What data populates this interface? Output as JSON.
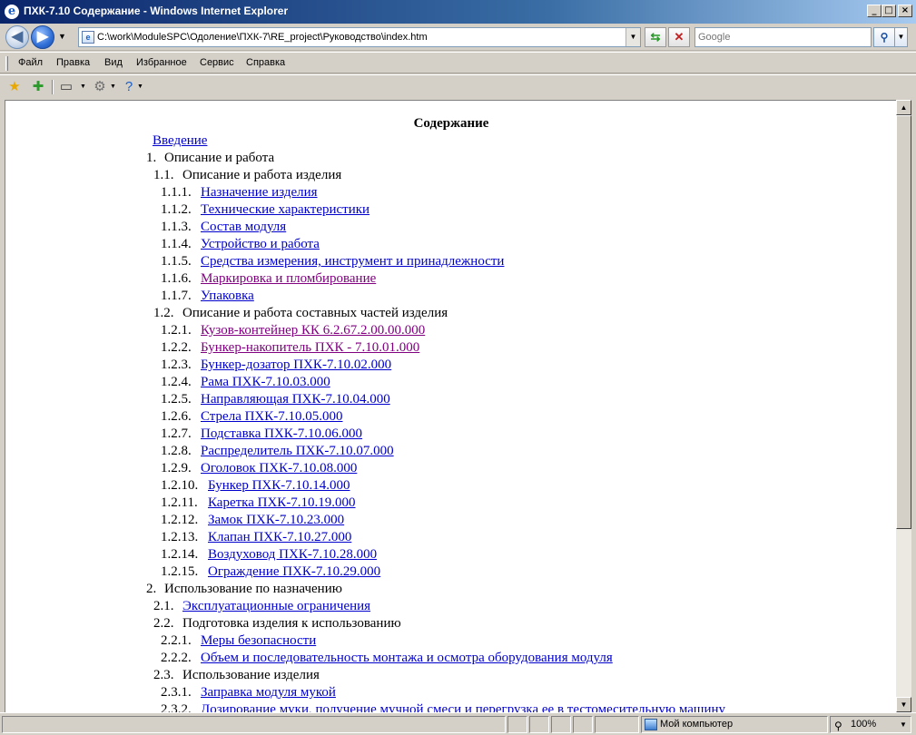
{
  "window": {
    "title": "ПХК-7.10 Содержание - Windows Internet Explorer",
    "minimize": "_",
    "maximize": "□",
    "close": "×"
  },
  "address": {
    "url": "C:\\work\\ModuleSPC\\Одоление\\ПХК-7\\RE_project\\Руководство\\index.htm"
  },
  "search": {
    "placeholder": "Google"
  },
  "menu": [
    "Файл",
    "Правка",
    "Вид",
    "Избранное",
    "Сервис",
    "Справка"
  ],
  "toolbar_icons": [
    "favorites-star-icon",
    "add-favorites-icon",
    "print-icon",
    "tools-gear-icon",
    "help-icon"
  ],
  "page": {
    "heading": "Содержание",
    "toc": [
      {
        "num": "",
        "text": "Введение",
        "link": true
      },
      {
        "num": "1.",
        "text": "Описание и работа",
        "link": false
      },
      {
        "num": "1.1.",
        "text": "Описание и работа изделия",
        "link": false
      },
      {
        "num": "1.1.1.",
        "text": "Назначение изделия",
        "link": true
      },
      {
        "num": "1.1.2.",
        "text": "Технические характеристики",
        "link": true
      },
      {
        "num": "1.1.3.",
        "text": "Состав модуля",
        "link": true
      },
      {
        "num": "1.1.4.",
        "text": "Устройство и работа",
        "link": true
      },
      {
        "num": "1.1.5.",
        "text": "Средства измерения, инструмент и принадлежности",
        "link": true
      },
      {
        "num": "1.1.6.",
        "text": "Маркировка и пломбирование",
        "link": true,
        "visited": true
      },
      {
        "num": "1.1.7.",
        "text": "Упаковка",
        "link": true
      },
      {
        "num": "1.2.",
        "text": "Описание и работа составных частей изделия",
        "link": false
      },
      {
        "num": "1.2.1.",
        "text": "Кузов-контейнер КК 6.2.67.2.00.00.000",
        "link": true,
        "visited": true
      },
      {
        "num": "1.2.2.",
        "text": "Бункер-накопитель ПХК - 7.10.01.000",
        "link": true,
        "visited": true
      },
      {
        "num": "1.2.3.",
        "text": "Бункер-дозатор ПХК-7.10.02.000",
        "link": true
      },
      {
        "num": "1.2.4.",
        "text": "Рама ПХК-7.10.03.000",
        "link": true
      },
      {
        "num": "1.2.5.",
        "text": "Направляющая ПХК-7.10.04.000",
        "link": true
      },
      {
        "num": "1.2.6.",
        "text": "Стрела ПХК-7.10.05.000",
        "link": true
      },
      {
        "num": "1.2.7.",
        "text": "Подставка ПХК-7.10.06.000",
        "link": true
      },
      {
        "num": "1.2.8.",
        "text": "Распределитель ПХК-7.10.07.000",
        "link": true
      },
      {
        "num": "1.2.9.",
        "text": "Оголовок ПХК-7.10.08.000",
        "link": true
      },
      {
        "num": "1.2.10.",
        "text": "Бункер ПХК-7.10.14.000",
        "link": true
      },
      {
        "num": "1.2.11.",
        "text": "Каретка ПХК-7.10.19.000",
        "link": true
      },
      {
        "num": "1.2.12.",
        "text": "Замок ПХК-7.10.23.000",
        "link": true
      },
      {
        "num": "1.2.13.",
        "text": "Клапан ПХК-7.10.27.000",
        "link": true
      },
      {
        "num": "1.2.14.",
        "text": "Воздуховод ПХК-7.10.28.000",
        "link": true
      },
      {
        "num": "1.2.15.",
        "text": "Ограждение ПХК-7.10.29.000",
        "link": true
      },
      {
        "num": "2.",
        "text": "Использование по назначению",
        "link": false
      },
      {
        "num": "2.1.",
        "text": "Эксплуатационные ограничения",
        "link": true
      },
      {
        "num": "2.2.",
        "text": "Подготовка изделия к использованию",
        "link": false
      },
      {
        "num": "2.2.1.",
        "text": "Меры безопасности",
        "link": true
      },
      {
        "num": "2.2.2.",
        "text": "Объем и последовательность монтажа и осмотра оборудования модуля",
        "link": true
      },
      {
        "num": "2.3.",
        "text": "Использование изделия",
        "link": false
      },
      {
        "num": "2.3.1.",
        "text": "Заправка модуля мукой",
        "link": true
      },
      {
        "num": "2.3.2.",
        "text": "Дозирование муки, получение мучной смеси и перегрузка ее в тестомесительную машину",
        "link": true
      }
    ]
  },
  "status": {
    "zone": "Мой компьютер",
    "zoom": "100%"
  }
}
